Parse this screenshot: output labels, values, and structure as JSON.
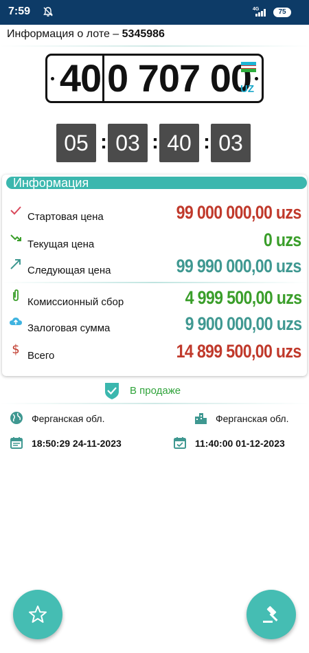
{
  "status_bar": {
    "time": "7:59",
    "network": "4G",
    "battery": "75"
  },
  "lot": {
    "title_prefix": "Информация о лоте – ",
    "number": "5345986"
  },
  "plate": {
    "region": "40",
    "number": "0 707 00",
    "country": "UZ"
  },
  "timer": [
    "05",
    "03",
    "40",
    "03"
  ],
  "info": {
    "header": "Информация",
    "rows": [
      {
        "icon": "check-icon",
        "label": "Стартовая цена",
        "value": "99 000 000,00 uzs",
        "color": "#c0392b"
      },
      {
        "icon": "trend-down-icon",
        "label": "Текущая цена",
        "value": "0 uzs",
        "color": "#3a9e2a"
      },
      {
        "icon": "trend-up-icon",
        "label": "Следующая цена",
        "value": "99 990 000,00 uzs",
        "color": "#3f9891"
      },
      {
        "icon": "paperclip-icon",
        "label": "Комиссионный сбор",
        "value": "4 999 500,00 uzs",
        "color": "#3a9e2a"
      },
      {
        "icon": "cloud-upload-icon",
        "label": "Залоговая сумма",
        "value": "9 900 000,00 uzs",
        "color": "#3f9891"
      },
      {
        "icon": "dollar-icon",
        "label": "Всего",
        "value": "14 899 500,00 uzs",
        "color": "#c0392b"
      }
    ]
  },
  "status": {
    "text": "В продаже",
    "color": "#2fa33a"
  },
  "location": {
    "region": "Ферганская обл.",
    "city": "Ферганская обл."
  },
  "dates": {
    "start": "18:50:29 24-11-2023",
    "end": "11:40:00 01-12-2023"
  },
  "colors": {
    "accent": "#45bdb3",
    "statusbar": "#0d3b67"
  }
}
